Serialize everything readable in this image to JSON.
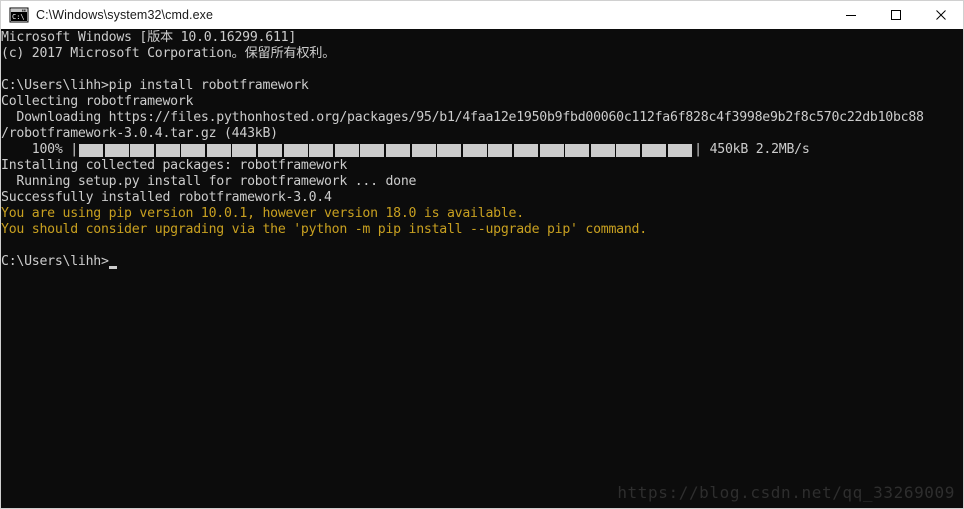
{
  "titlebar": {
    "icon": "cmd-window-icon",
    "title": "C:\\Windows\\system32\\cmd.exe",
    "minimize_label": "—",
    "maximize_label": "□",
    "close_label": "×"
  },
  "console": {
    "background_color": "#0c0c0c",
    "foreground_color": "#cccccc",
    "warning_color": "#c8a020",
    "lines": [
      {
        "text": "Microsoft Windows [版本 10.0.16299.611]",
        "color": "default"
      },
      {
        "text": "(c) 2017 Microsoft Corporation。保留所有权利。",
        "color": "default"
      },
      {
        "text": "",
        "color": "default"
      },
      {
        "text": "C:\\Users\\lihh>pip install robotframework",
        "color": "default"
      },
      {
        "text": "Collecting robotframework",
        "color": "default"
      },
      {
        "text": "  Downloading https://files.pythonhosted.org/packages/95/b1/4faa12e1950b9fbd00060c112fa6f828c4f3998e9b2f8c570c22db10bc88",
        "color": "default"
      },
      {
        "text": "/robotframework-3.0.4.tar.gz (443kB)",
        "color": "default"
      },
      {
        "text": "PROGRESS_BAR",
        "color": "default"
      },
      {
        "text": "Installing collected packages: robotframework",
        "color": "default"
      },
      {
        "text": "  Running setup.py install for robotframework ... done",
        "color": "default"
      },
      {
        "text": "Successfully installed robotframework-3.0.4",
        "color": "default"
      },
      {
        "text": "You are using pip version 10.0.1, however version 18.0 is available.",
        "color": "warning"
      },
      {
        "text": "You should consider upgrading via the 'python -m pip install --upgrade pip' command.",
        "color": "warning"
      },
      {
        "text": "",
        "color": "default"
      },
      {
        "text": "PROMPT",
        "color": "default"
      }
    ],
    "progress": {
      "percent_label": "    100% ",
      "left_pipe": "|",
      "right_pipe": "|",
      "block_count": 24,
      "stats": " 450kB 2.2MB/s"
    },
    "prompt": {
      "text": "C:\\Users\\lihh>",
      "cursor": "block-cursor"
    }
  },
  "watermark": {
    "text": "https://blog.csdn.net/qq_33269009"
  }
}
